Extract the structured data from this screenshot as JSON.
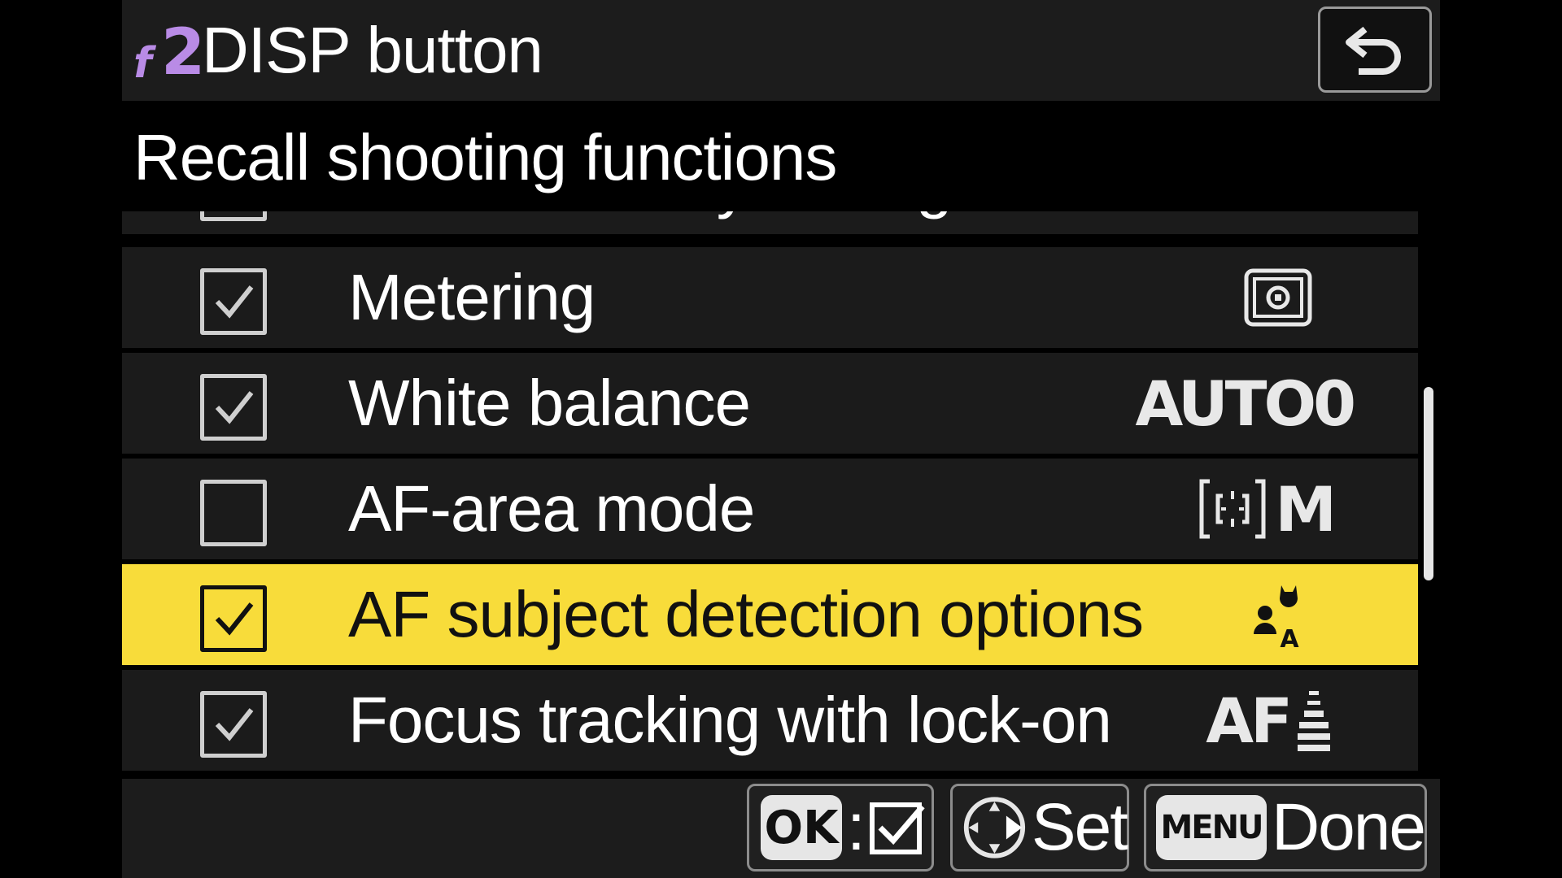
{
  "header": {
    "menu_letter": "f",
    "menu_number": "2",
    "title": "DISP button"
  },
  "subtitle": "Recall shooting functions",
  "list": {
    "partial_item": {
      "label": "ISO sensitivity settings",
      "checked": false
    },
    "items": [
      {
        "label": "Metering",
        "checked": true,
        "value_icon": "matrix-metering-icon",
        "selected": false
      },
      {
        "label": "White balance",
        "checked": true,
        "value": "AUTO0",
        "selected": false
      },
      {
        "label": "AF-area mode",
        "checked": false,
        "value": "M",
        "value_icon": "af-area-bracket-icon",
        "selected": false
      },
      {
        "label": "AF subject detection options",
        "checked": true,
        "value_icon": "subject-detection-auto-icon",
        "selected": true
      },
      {
        "label": "Focus tracking with lock-on",
        "checked": true,
        "value": "AF",
        "value_icon": "tracking-bars-icon",
        "selected": false
      }
    ]
  },
  "footer": {
    "ok_key": "OK",
    "ok_sep": ":",
    "set_label": "Set",
    "menu_key": "MENU",
    "done_label": "Done"
  },
  "colors": {
    "accent": "#f8dc3a",
    "menu_code": "#b98be6",
    "row_bg": "#1b1b1b"
  }
}
